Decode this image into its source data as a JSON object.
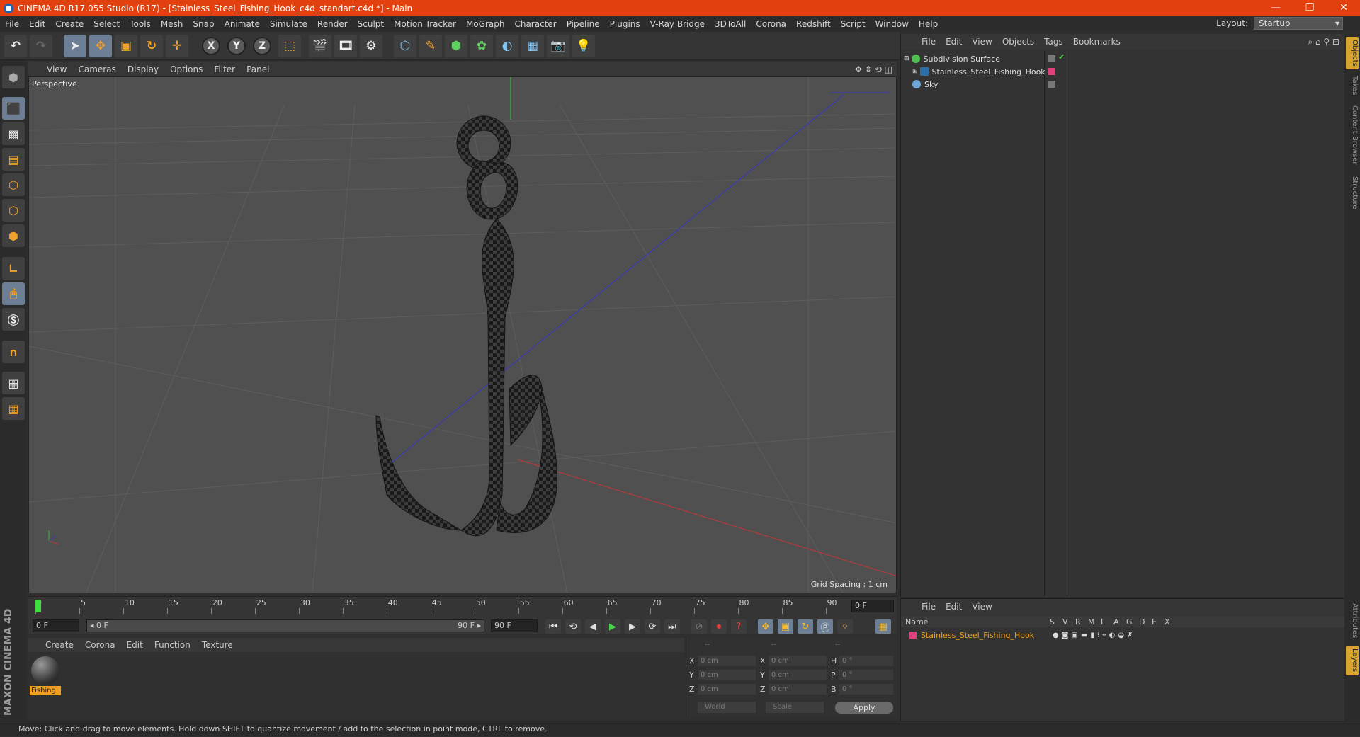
{
  "window": {
    "title": "CINEMA 4D R17.055 Studio (R17) - [Stainless_Steel_Fishing_Hook_c4d_standart.c4d *] - Main",
    "minimize": "—",
    "maximize": "❐",
    "close": "✕"
  },
  "menu": [
    "File",
    "Edit",
    "Create",
    "Select",
    "Tools",
    "Mesh",
    "Snap",
    "Animate",
    "Simulate",
    "Render",
    "Sculpt",
    "Motion Tracker",
    "MoGraph",
    "Character",
    "Pipeline",
    "Plugins",
    "V-Ray Bridge",
    "3DToAll",
    "Corona",
    "Redshift",
    "Script",
    "Window",
    "Help"
  ],
  "layout": {
    "label": "Layout:",
    "value": "Startup"
  },
  "toolbar": {
    "x": "X",
    "y": "Y",
    "z": "Z"
  },
  "viewport": {
    "menu": [
      "View",
      "Cameras",
      "Display",
      "Options",
      "Filter",
      "Panel"
    ],
    "label": "Perspective",
    "grid_spacing": "Grid Spacing : 1 cm"
  },
  "timeline": {
    "ticks": [
      "0",
      "5",
      "10",
      "15",
      "20",
      "25",
      "30",
      "35",
      "40",
      "45",
      "50",
      "55",
      "60",
      "65",
      "70",
      "75",
      "80",
      "85",
      "90"
    ],
    "current_frame": "0 F",
    "start": "0 F",
    "range_start": "◂ 0 F",
    "range_end": "90 F ▸",
    "end": "90 F"
  },
  "material_panel": {
    "menu": [
      "Create",
      "Corona",
      "Edit",
      "Function",
      "Texture"
    ],
    "material_name": "Fishing"
  },
  "coords": {
    "headers": [
      "--",
      "--",
      "--"
    ],
    "rows": [
      {
        "a": "X",
        "av": "0 cm",
        "b": "X",
        "bv": "0 cm",
        "c": "H",
        "cv": "0 °"
      },
      {
        "a": "Y",
        "av": "0 cm",
        "b": "Y",
        "bv": "0 cm",
        "c": "P",
        "cv": "0 °"
      },
      {
        "a": "Z",
        "av": "0 cm",
        "b": "Z",
        "bv": "0 cm",
        "c": "B",
        "cv": "0 °"
      }
    ],
    "world": "World",
    "scale": "Scale",
    "apply": "Apply"
  },
  "object_manager": {
    "menu": [
      "File",
      "Edit",
      "View",
      "Objects",
      "Tags",
      "Bookmarks"
    ],
    "objects": [
      {
        "name": "Subdivision Surface"
      },
      {
        "name": "Stainless_Steel_Fishing_Hook"
      },
      {
        "name": "Sky"
      }
    ]
  },
  "layer_manager": {
    "menu": [
      "File",
      "Edit",
      "View"
    ],
    "header_name": "Name",
    "columns": [
      "S",
      "V",
      "R",
      "M",
      "L",
      "A",
      "G",
      "D",
      "E",
      "X"
    ],
    "layer": "Stainless_Steel_Fishing_Hook"
  },
  "right_tabs": [
    "Objects",
    "Takes",
    "Content Browser",
    "Structure"
  ],
  "right_tabs_lower": [
    "Attributes",
    "Layers"
  ],
  "maxon": "MAXON CINEMA 4D",
  "status": "Move: Click and drag to move elements. Hold down SHIFT to quantize movement / add to the selection in point mode, CTRL to remove.",
  "colors": {
    "title_bar": "#e2400f",
    "accent": "#f0a020",
    "layer_pink": "#e0407e"
  }
}
